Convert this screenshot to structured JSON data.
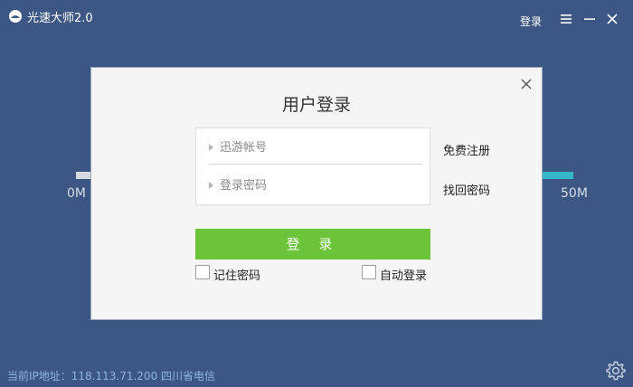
{
  "app": {
    "title": "光速大师2.0",
    "login_link": "登录"
  },
  "gauge": {
    "min_label": "0M",
    "max_label": "50M"
  },
  "dialog": {
    "title": "用户登录",
    "account_placeholder": "迅游帐号",
    "password_placeholder": "登录密码",
    "register_link": "免费注册",
    "forgot_link": "找回密码",
    "submit_label": "登 录",
    "remember_label": "记住密码",
    "auto_login_label": "自动登录"
  },
  "footer": {
    "ip_info": "当前IP地址：118.113.71.200 四川省电信"
  },
  "icons": {
    "logo": "app-logo-icon",
    "menu": "menu-icon",
    "minimize": "minimize-icon",
    "close": "close-icon",
    "settings": "gear-icon"
  },
  "colors": {
    "background": "#3c5783",
    "accent_green": "#6cc43a",
    "gauge_cyan": "#35b6c9",
    "footer_text": "#8fb3e0"
  }
}
